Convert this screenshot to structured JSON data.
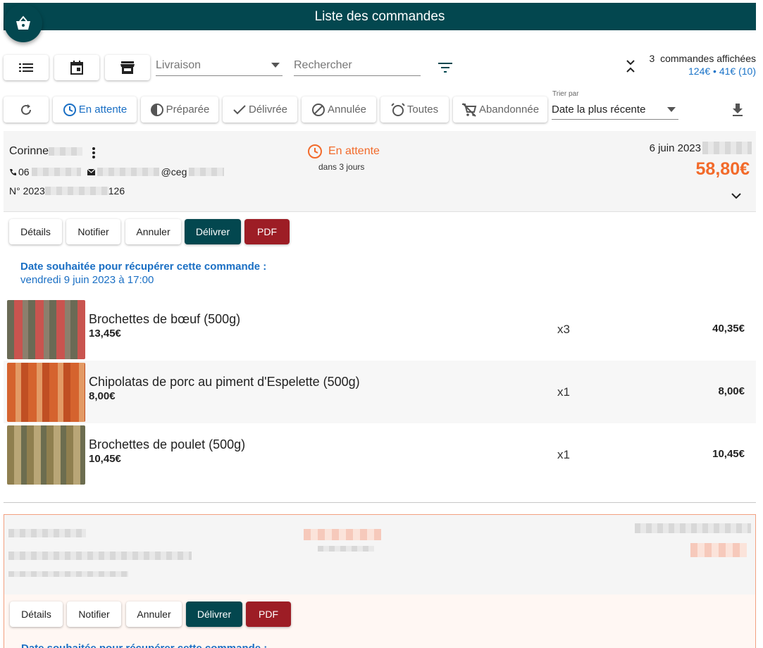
{
  "header": {
    "title": "Liste des commandes"
  },
  "toolbar": {
    "delivery_placeholder": "Livraison",
    "search_placeholder": "Rechercher",
    "counter_count": "3",
    "counter_label": "commandes affichées",
    "counter_amounts": "124€ • 41€ (10)"
  },
  "filters": [
    {
      "label": "En attente"
    },
    {
      "label": "Préparée"
    },
    {
      "label": "Délivrée"
    },
    {
      "label": "Annulée"
    },
    {
      "label": "Toutes"
    },
    {
      "label": "Abandonnée"
    }
  ],
  "sort": {
    "label": "Trier par",
    "value": "Date la plus récente"
  },
  "order1": {
    "customer_name": "Corinne",
    "phone_prefix": "06",
    "email_fragment": "@ceg",
    "number_prefix": "N° 2023",
    "number_suffix": "126",
    "status": "En attente",
    "status_sub": "dans 3 jours",
    "date": "6 juin 2023",
    "total": "58,80€",
    "actions": {
      "details": "Détails",
      "notify": "Notifier",
      "cancel": "Annuler",
      "deliver": "Délivrer",
      "pdf": "PDF"
    },
    "pickup_label": "Date souhaitée pour récupérer cette commande :",
    "pickup_value": "vendredi 9 juin 2023 à 17:00",
    "items": [
      {
        "name": "Brochettes de bœuf (500g)",
        "unit_price": "13,45€",
        "qty": "x3",
        "total": "40,35€"
      },
      {
        "name": "Chipolatas de porc au piment d'Espelette (500g)",
        "unit_price": "8,00€",
        "qty": "x1",
        "total": "8,00€"
      },
      {
        "name": "Brochettes de poulet (500g)",
        "unit_price": "10,45€",
        "qty": "x1",
        "total": "10,45€"
      }
    ]
  },
  "order2": {
    "actions": {
      "details": "Détails",
      "notify": "Notifier",
      "cancel": "Annuler",
      "deliver": "Délivrer",
      "pdf": "PDF"
    },
    "pickup_label": "Date souhaitée pour récupérer cette commande :"
  },
  "colors": {
    "primary": "#03474f",
    "pdf": "#9d1d25",
    "accent_orange": "#f26a2a",
    "link_blue": "#1a6fc4"
  },
  "icons": [
    "basket-icon",
    "list-icon",
    "calendar-icon",
    "store-icon",
    "filter-icon",
    "collapse-icon",
    "refresh-icon",
    "clock-icon",
    "half-circle-icon",
    "check-icon",
    "cancel-circle-icon",
    "alarm-icon",
    "cart-off-icon",
    "download-icon",
    "more-vert-icon",
    "phone-icon",
    "email-icon",
    "chevron-down-icon"
  ]
}
